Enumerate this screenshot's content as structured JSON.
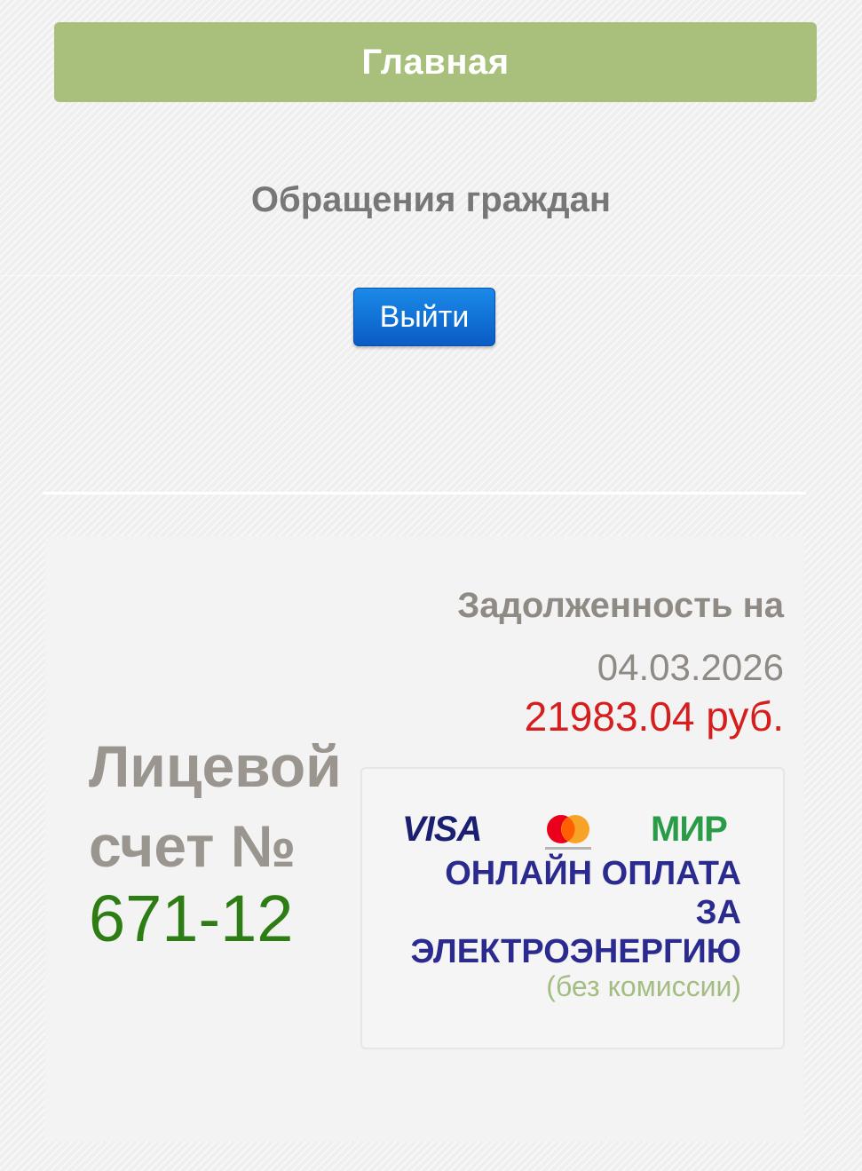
{
  "nav": {
    "main_label": "Главная",
    "appeals_label": "Обращения граждан",
    "logout_label": "Выйти"
  },
  "account": {
    "label_line1": "Лицевой",
    "label_line2": "счет №",
    "number": "671-12"
  },
  "debt": {
    "label": "Задолженность на",
    "date": "04.03.2026",
    "amount": "21983.04 руб."
  },
  "payment": {
    "logos": [
      "VISA",
      "mastercard-icon",
      "МИР"
    ],
    "visa_text": "VISA",
    "mir_text": "МИР",
    "title_line1": "ОНЛАЙН ОПЛАТА",
    "title_line2": "ЗА",
    "title_line3": "ЭЛЕКТРОЭНЕРГИЮ",
    "subtitle": "(без комиссии)"
  },
  "colors": {
    "nav_main_bg": "#a8c07c",
    "logout_bg": "#0a6fd8",
    "account_number": "#2e7d14",
    "debt_amount": "#d61e1e",
    "pay_title": "#2b2a8f",
    "pay_subtitle": "#a3bd82"
  }
}
